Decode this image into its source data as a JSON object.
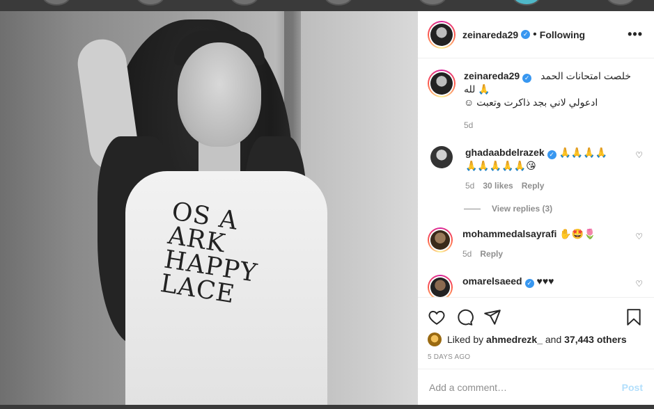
{
  "post": {
    "author": "zeinareda29",
    "follow_status": "Following",
    "more_icon": "ellipsis-icon",
    "shirt_lines": [
      "OS A",
      "ARK",
      "HAPPY",
      "LACE"
    ]
  },
  "caption": {
    "username": "zeinareda29",
    "text_line1": "خلصت امتحانات الحمد",
    "text_line2": "لله 🙏",
    "text_line3": "ادعولي لاني بجد ذاكرت وتعبت ☺",
    "age": "5d"
  },
  "comments": [
    {
      "username": "ghadaabdelrazek",
      "verified": true,
      "text": "🙏🙏🙏🙏 🙏🙏🙏🙏🙏😘",
      "age": "5d",
      "likes": "30 likes",
      "reply": "Reply",
      "view_replies": "View replies (3)"
    },
    {
      "username": "mohammedalsayrafi",
      "verified": false,
      "text": "✋🤩🌷",
      "age": "5d",
      "reply": "Reply"
    },
    {
      "username": "omarelsaeed",
      "verified": true,
      "text": "♥♥♥"
    }
  ],
  "footer": {
    "liked_prefix": "Liked by",
    "liked_user": "ahmedrezk_",
    "liked_mid": "and",
    "liked_count": "37,443 others",
    "date": "5 DAYS AGO",
    "comment_placeholder": "Add a comment…",
    "post_label": "Post"
  },
  "colors": {
    "verified": "#3897f0",
    "post_disabled": "#b2dffc",
    "muted": "#8e8e8e"
  }
}
